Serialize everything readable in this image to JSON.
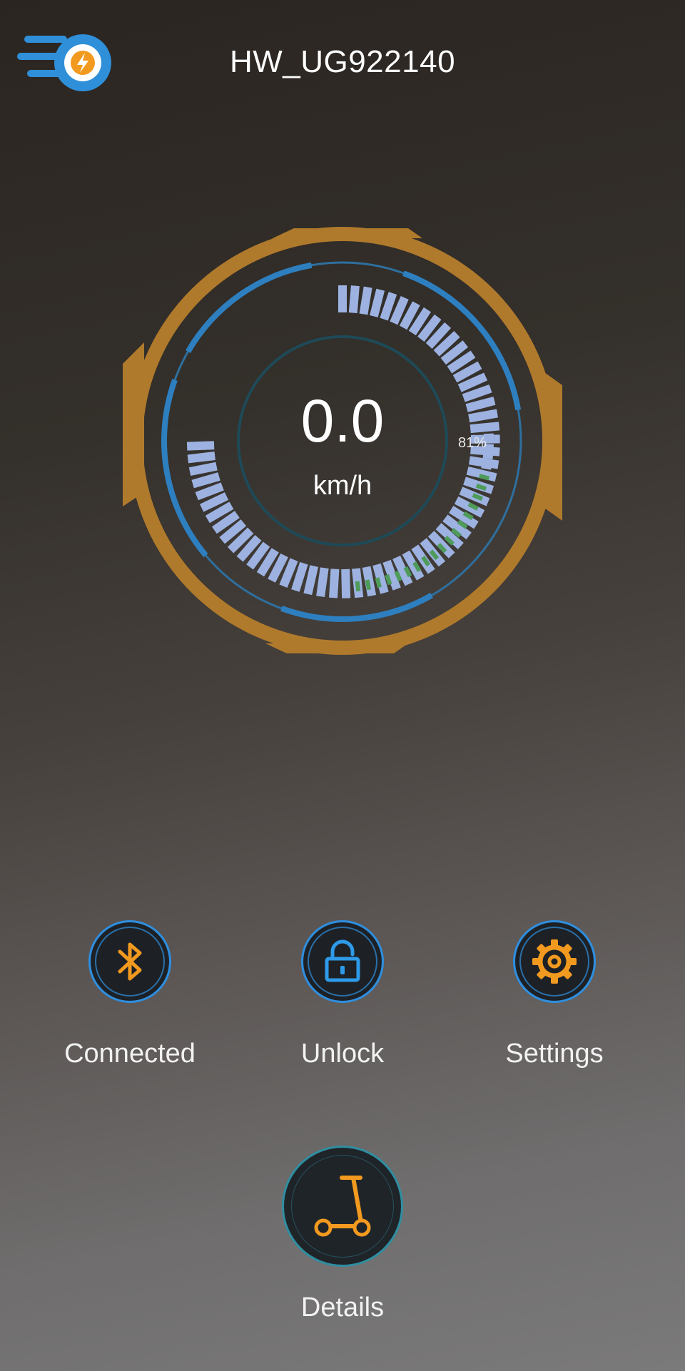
{
  "header": {
    "device_name": "HW_UG922140",
    "logo_icon": "app-logo-lightning-icon"
  },
  "dashboard": {
    "speed": "0.0",
    "speed_unit": "km/h",
    "battery_label": "81%",
    "battery_level": 0.81,
    "colors": {
      "outer_ring": "#b07a2c",
      "accent_blue": "#2e7fbf",
      "segment": "#9db2e0",
      "battery_segment": "#4e9b5a"
    }
  },
  "actions": [
    {
      "label": "Connected",
      "icon": "bluetooth-icon"
    },
    {
      "label": "Unlock",
      "icon": "unlock-icon"
    },
    {
      "label": "Settings",
      "icon": "gear-icon"
    }
  ],
  "details": {
    "label": "Details",
    "icon": "scooter-icon"
  }
}
